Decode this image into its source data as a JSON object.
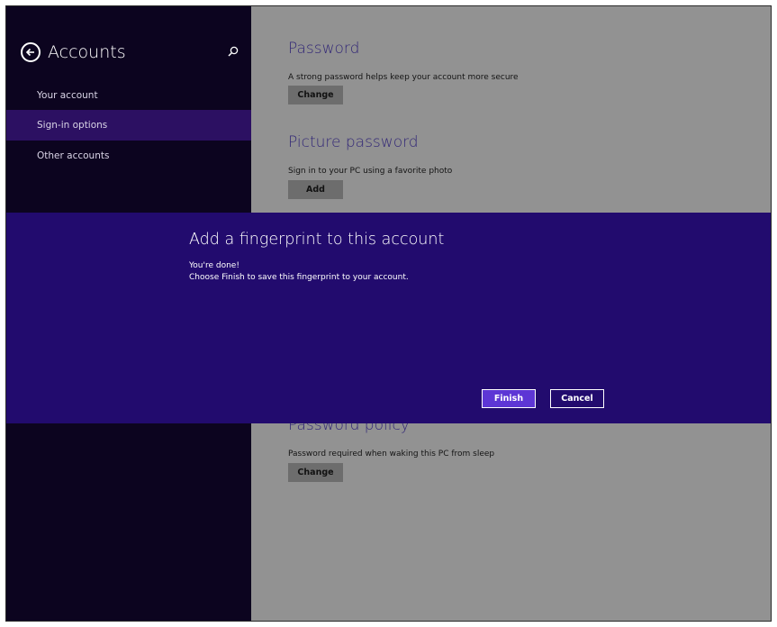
{
  "sidebar": {
    "title": "Accounts",
    "back_icon": "back-arrow-circle-icon",
    "search_icon": "search-icon",
    "items": [
      {
        "label": "Your account"
      },
      {
        "label": "Sign-in options",
        "selected": true
      },
      {
        "label": "Other accounts"
      }
    ]
  },
  "content": {
    "password": {
      "title": "Password",
      "description": "A strong password helps keep your account more secure",
      "button": "Change"
    },
    "picture_password": {
      "title": "Picture password",
      "description": "Sign in to your PC using a favorite photo",
      "button": "Add"
    },
    "password_policy": {
      "title": "Password policy",
      "description": "Password required when waking this PC from sleep",
      "button": "Change"
    }
  },
  "dialog": {
    "title": "Add a fingerprint to this account",
    "message_line1": "You're done!",
    "message_line2": "Choose Finish to save this fingerprint to your account.",
    "finish_label": "Finish",
    "cancel_label": "Cancel"
  },
  "colors": {
    "sidebar_bg": "#0c041f",
    "sidebar_selected": "#2c1062",
    "content_bg": "#929292",
    "dialog_bg": "#220b6e",
    "accent": "#5d36d5",
    "heading": "#332877"
  }
}
